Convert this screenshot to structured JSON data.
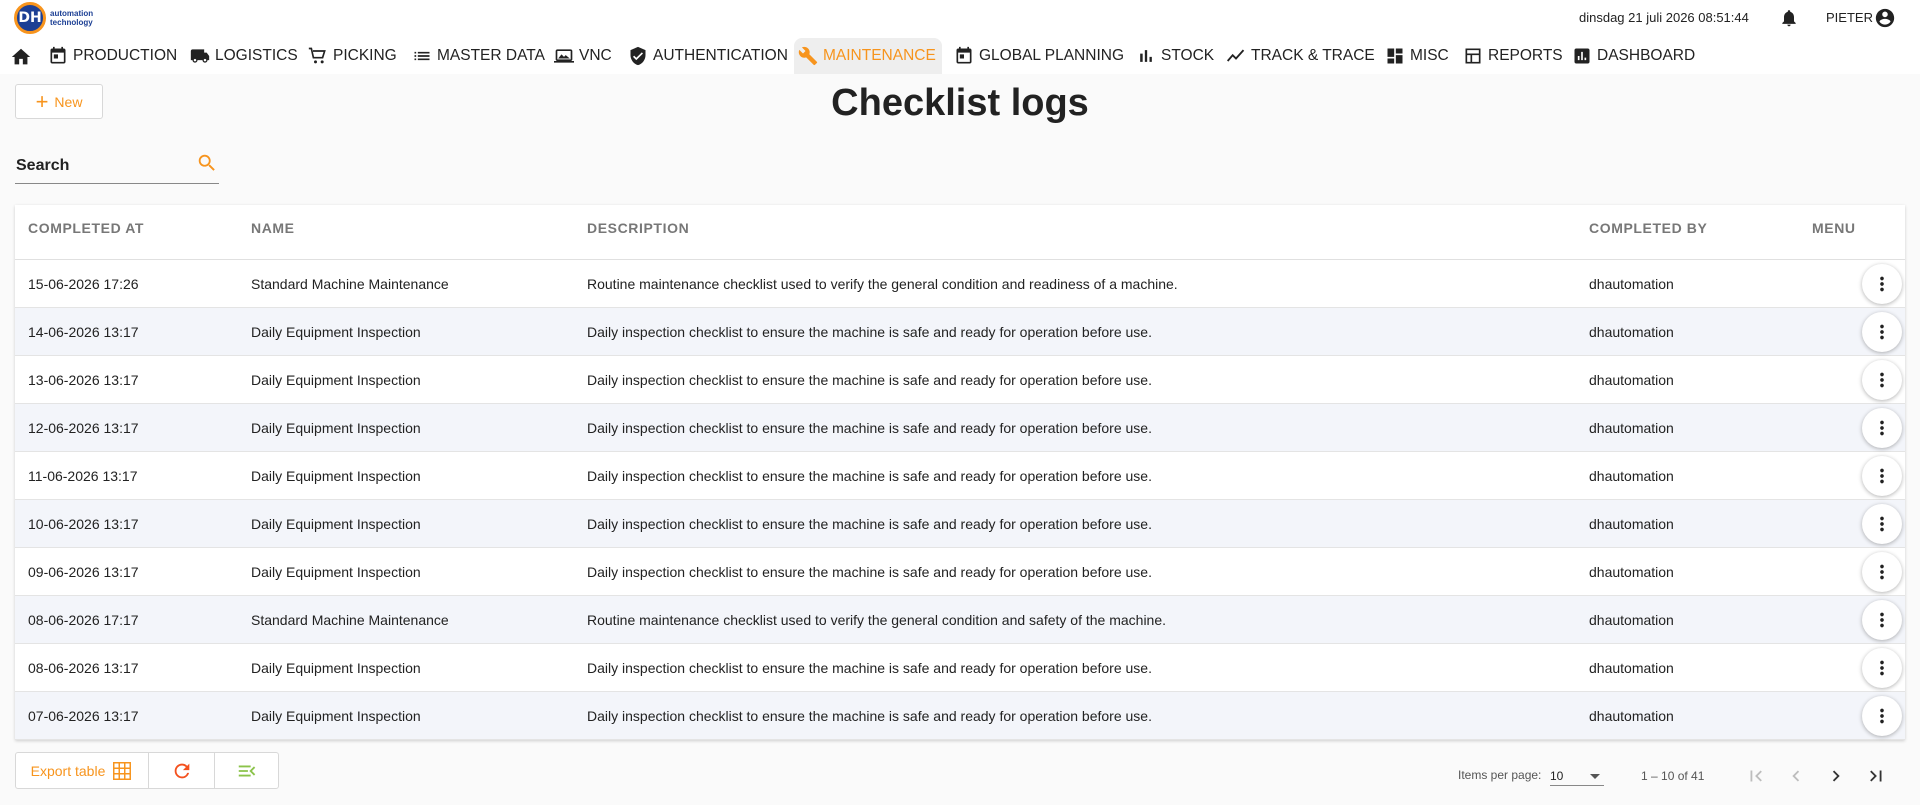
{
  "header": {
    "logo_letters": "DH",
    "logo_line1": "automation",
    "logo_line2": "technology",
    "datetime": "dinsdag 21 juli 2026 08:51:44",
    "user": "PIETER"
  },
  "nav": {
    "items": [
      {
        "label": "PRODUCTION",
        "icon": "calendar-icon"
      },
      {
        "label": "LOGISTICS",
        "icon": "truck-icon"
      },
      {
        "label": "PICKING",
        "icon": "cart-icon"
      },
      {
        "label": "MASTER DATA",
        "icon": "list-icon"
      },
      {
        "label": "VNC",
        "icon": "laptop-icon"
      },
      {
        "label": "AUTHENTICATION",
        "icon": "shield-icon"
      },
      {
        "label": "MAINTENANCE",
        "icon": "wrench-icon",
        "active": true
      },
      {
        "label": "GLOBAL PLANNING",
        "icon": "calendar-icon"
      },
      {
        "label": "STOCK",
        "icon": "bar-chart-icon"
      },
      {
        "label": "TRACK & TRACE",
        "icon": "trend-icon"
      },
      {
        "label": "MISC",
        "icon": "dashboard-icon"
      },
      {
        "label": "REPORTS",
        "icon": "report-icon"
      },
      {
        "label": "DASHBOARD",
        "icon": "analytics-icon"
      }
    ]
  },
  "toolbar": {
    "new_label": "New"
  },
  "page": {
    "title": "Checklist logs"
  },
  "search": {
    "placeholder": "Search",
    "value": ""
  },
  "table": {
    "columns": [
      "COMPLETED AT",
      "NAME",
      "DESCRIPTION",
      "COMPLETED BY",
      "MENU"
    ],
    "rows": [
      {
        "completed_at": "15-06-2026 17:26",
        "name": "Standard Machine Maintenance",
        "description": "Routine maintenance checklist used to verify the general condition and readiness of a machine.",
        "completed_by": "dhautomation"
      },
      {
        "completed_at": "14-06-2026 13:17",
        "name": "Daily Equipment Inspection",
        "description": "Daily inspection checklist to ensure the machine is safe and ready for operation before use.",
        "completed_by": "dhautomation"
      },
      {
        "completed_at": "13-06-2026 13:17",
        "name": "Daily Equipment Inspection",
        "description": "Daily inspection checklist to ensure the machine is safe and ready for operation before use.",
        "completed_by": "dhautomation"
      },
      {
        "completed_at": "12-06-2026 13:17",
        "name": "Daily Equipment Inspection",
        "description": "Daily inspection checklist to ensure the machine is safe and ready for operation before use.",
        "completed_by": "dhautomation"
      },
      {
        "completed_at": "11-06-2026 13:17",
        "name": "Daily Equipment Inspection",
        "description": "Daily inspection checklist to ensure the machine is safe and ready for operation before use.",
        "completed_by": "dhautomation"
      },
      {
        "completed_at": "10-06-2026 13:17",
        "name": "Daily Equipment Inspection",
        "description": "Daily inspection checklist to ensure the machine is safe and ready for operation before use.",
        "completed_by": "dhautomation"
      },
      {
        "completed_at": "09-06-2026 13:17",
        "name": "Daily Equipment Inspection",
        "description": "Daily inspection checklist to ensure the machine is safe and ready for operation before use.",
        "completed_by": "dhautomation"
      },
      {
        "completed_at": "08-06-2026 17:17",
        "name": "Standard Machine Maintenance",
        "description": "Routine maintenance checklist used to verify the general condition and safety of the machine.",
        "completed_by": "dhautomation"
      },
      {
        "completed_at": "08-06-2026 13:17",
        "name": "Daily Equipment Inspection",
        "description": "Daily inspection checklist to ensure the machine is safe and ready for operation before use.",
        "completed_by": "dhautomation"
      },
      {
        "completed_at": "07-06-2026 13:17",
        "name": "Daily Equipment Inspection",
        "description": "Daily inspection checklist to ensure the machine is safe and ready for operation before use.",
        "completed_by": "dhautomation"
      }
    ]
  },
  "footer": {
    "export_label": "Export table",
    "items_per_page_label": "Items per page:",
    "items_per_page": "10",
    "range": "1 – 10 of 41"
  },
  "colors": {
    "accent": "#f7941d",
    "active_tab_bg": "#eeeeee",
    "row_alt": "#f3f5fa",
    "green_icon": "#8bc34a"
  }
}
